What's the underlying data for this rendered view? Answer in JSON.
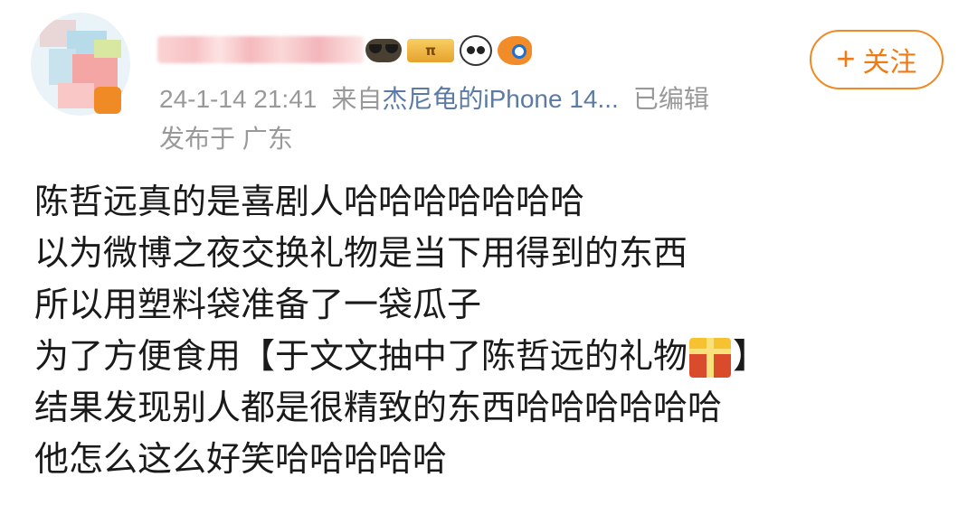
{
  "post": {
    "timestamp": "24-1-14 21:41",
    "source_prefix": "来自",
    "source": "杰尼龟的iPhone 14...",
    "edited": "已编辑",
    "location": "发布于 广东",
    "follow_label": "关注",
    "follow_plus": "+",
    "fan_badge_text": "π",
    "lines": [
      "陈哲远真的是喜剧人哈哈哈哈哈哈哈",
      "以为微博之夜交换礼物是当下用得到的东西",
      "所以用塑料袋准备了一袋瓜子"
    ],
    "line4_before_icon": "为了方便食用【于文文抽中了陈哲远的礼物",
    "line4_after_icon": "】",
    "line5": "结果发现别人都是很精致的东西哈哈哈哈哈哈",
    "line6": "他怎么这么好笑哈哈哈哈哈"
  },
  "icons": {
    "avatar": "avatar-image",
    "gift": "gift-icon",
    "badges": [
      "sunglasses-icon",
      "fan-level-badge",
      "panda-icon",
      "fish-icon"
    ]
  },
  "colors": {
    "accent": "#f07b14",
    "source_link": "#5b7ba6",
    "meta": "#999999"
  }
}
